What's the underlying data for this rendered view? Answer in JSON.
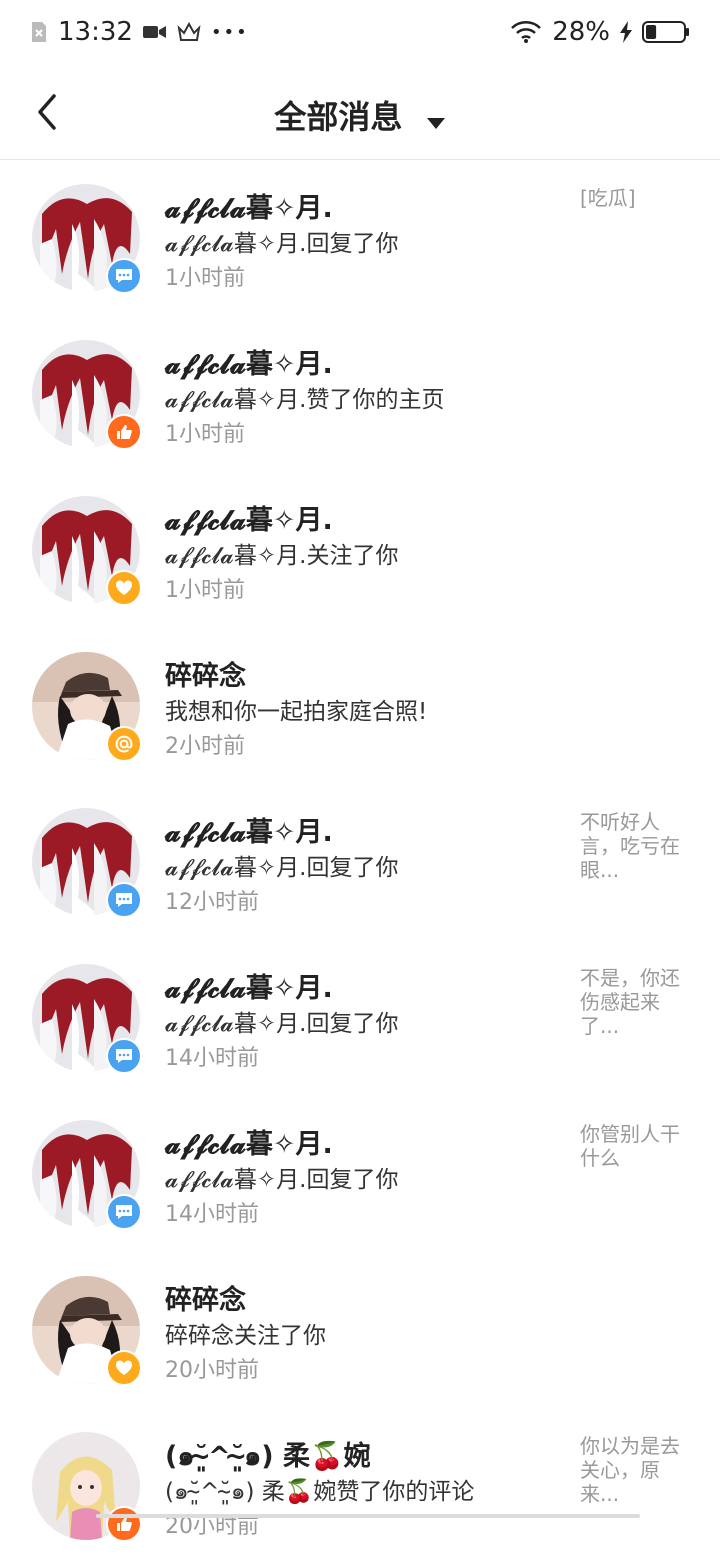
{
  "status": {
    "time": "13:32",
    "battery": "28%",
    "battery_fraction": 0.28,
    "dots": "•••"
  },
  "header": {
    "title": "全部消息"
  },
  "colors": {
    "comment": "#4aa3f0",
    "like": "#ff6a1c",
    "follow": "#ffaa1c",
    "mention": "#ffaa1c"
  },
  "messages": [
    {
      "name": "𝓪𝓯𝓯𝓬𝓵𝓪暮✧月.",
      "text": "𝓪𝓯𝓯𝓬𝓵𝓪暮✧月.回复了你",
      "time": "1小时前",
      "snippet": "[吃瓜]",
      "avatar": "red-hair",
      "badge": "comment-icon"
    },
    {
      "name": "𝓪𝓯𝓯𝓬𝓵𝓪暮✧月.",
      "text": "𝓪𝓯𝓯𝓬𝓵𝓪暮✧月.赞了你的主页",
      "time": "1小时前",
      "snippet": "",
      "avatar": "red-hair",
      "badge": "thumbs-up-icon"
    },
    {
      "name": "𝓪𝓯𝓯𝓬𝓵𝓪暮✧月.",
      "text": "𝓪𝓯𝓯𝓬𝓵𝓪暮✧月.关注了你",
      "time": "1小时前",
      "snippet": "",
      "avatar": "red-hair",
      "badge": "heart-icon"
    },
    {
      "name": "碎碎念",
      "text": "我想和你一起拍家庭合照!",
      "time": "2小时前",
      "snippet": "",
      "avatar": "cap-girl",
      "badge": "at-icon"
    },
    {
      "name": "𝓪𝓯𝓯𝓬𝓵𝓪暮✧月.",
      "text": "𝓪𝓯𝓯𝓬𝓵𝓪暮✧月.回复了你",
      "time": "12小时前",
      "snippet": "不听好人言，吃亏在眼...",
      "avatar": "red-hair",
      "badge": "comment-icon"
    },
    {
      "name": "𝓪𝓯𝓯𝓬𝓵𝓪暮✧月.",
      "text": "𝓪𝓯𝓯𝓬𝓵𝓪暮✧月.回复了你",
      "time": "14小时前",
      "snippet": "不是，你还伤感起来了...",
      "avatar": "red-hair",
      "badge": "comment-icon"
    },
    {
      "name": "𝓪𝓯𝓯𝓬𝓵𝓪暮✧月.",
      "text": "𝓪𝓯𝓯𝓬𝓵𝓪暮✧月.回复了你",
      "time": "14小时前",
      "snippet": "你管别人干什么",
      "avatar": "red-hair",
      "badge": "comment-icon"
    },
    {
      "name": "碎碎念",
      "text": "碎碎念关注了你",
      "time": "20小时前",
      "snippet": "",
      "avatar": "cap-girl",
      "badge": "heart-icon"
    },
    {
      "name": "(๑˘̴͈^˘̴͈๑) 柔🍒婉",
      "text": "(๑˘̴͈^˘̴͈๑) 柔🍒婉赞了你的评论",
      "time": "20小时前",
      "snippet": "你以为是去关心，原来...",
      "avatar": "anime-blonde",
      "badge": "thumbs-up-icon"
    }
  ]
}
